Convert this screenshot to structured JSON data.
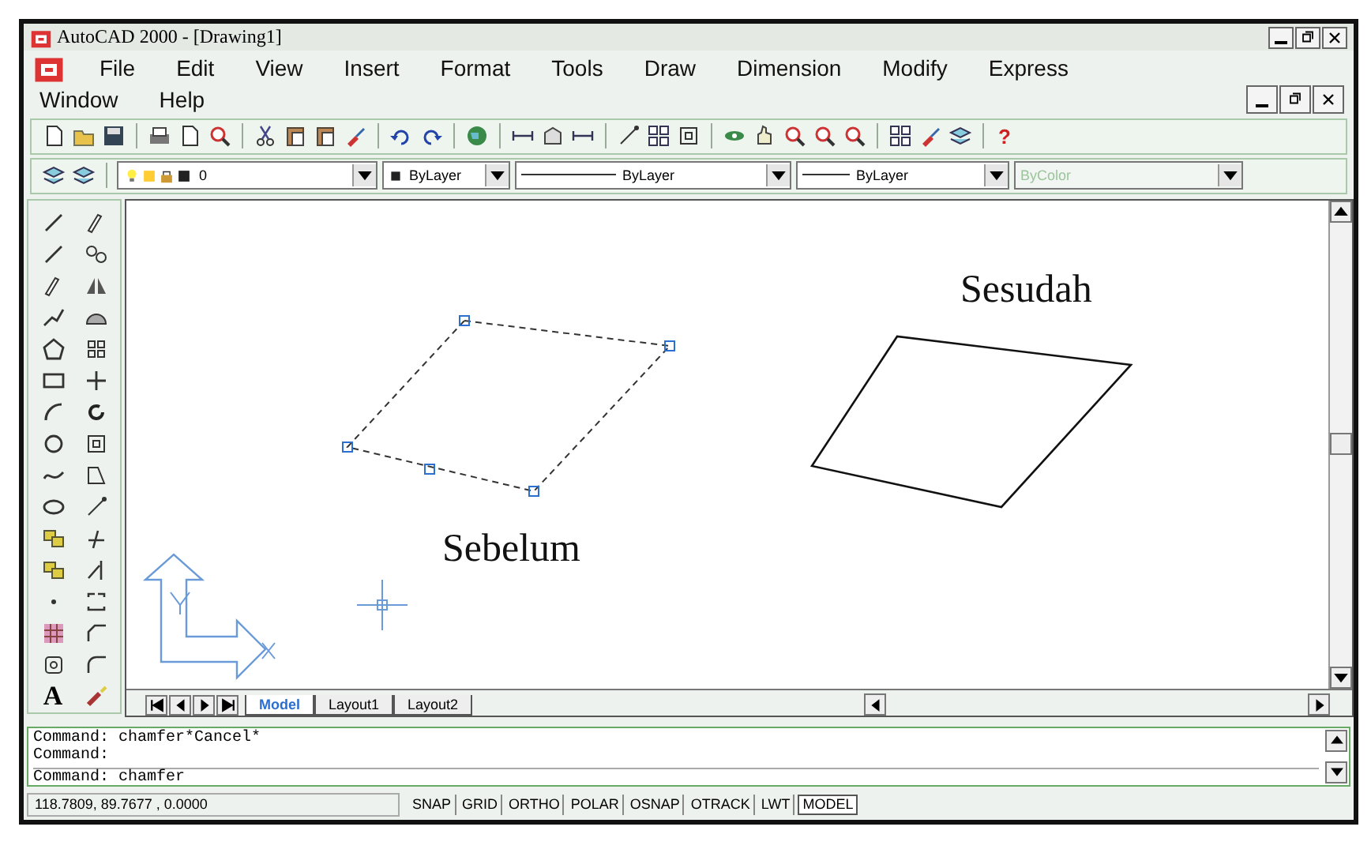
{
  "window": {
    "title": "AutoCAD 2000 - [Drawing1]"
  },
  "menu_bar": {
    "rows": [
      [
        "File",
        "Edit",
        "View",
        "Insert",
        "Format",
        "Tools",
        "Draw",
        "Dimension",
        "Modify",
        "Express"
      ],
      [
        "Window",
        "Help"
      ]
    ]
  },
  "help_button": "?",
  "properties_bar": {
    "dropdowns": [
      {
        "kind": "layer",
        "value": "0",
        "disabled": false
      },
      {
        "kind": "color",
        "value": "ByLayer",
        "disabled": false
      },
      {
        "kind": "linetype",
        "value": "ByLayer",
        "disabled": false
      },
      {
        "kind": "lineweight",
        "value": "ByLayer",
        "disabled": false
      },
      {
        "kind": "plotstyle",
        "value": "ByColor",
        "disabled": true
      }
    ]
  },
  "text_tool": "A",
  "drawing": {
    "labels": [
      "Sesudah",
      "Sebelum"
    ]
  },
  "layout_tabs": [
    {
      "label": "Model",
      "selected": true
    },
    {
      "label": "Layout1",
      "selected": false
    },
    {
      "label": "Layout2",
      "selected": false
    }
  ],
  "command_lines": [
    "Command: chamfer*Cancel*",
    "Command:",
    "Command: chamfer"
  ],
  "status_bar": {
    "coordinates": "118.7809, 89.7677 , 0.0000",
    "toggles": [
      {
        "label": "SNAP",
        "on": false
      },
      {
        "label": "GRID",
        "on": false
      },
      {
        "label": "ORTHO",
        "on": false
      },
      {
        "label": "POLAR",
        "on": false
      },
      {
        "label": "OSNAP",
        "on": false
      },
      {
        "label": "OTRACK",
        "on": false
      },
      {
        "label": "LWT",
        "on": false
      },
      {
        "label": "MODEL",
        "on": true
      }
    ]
  }
}
